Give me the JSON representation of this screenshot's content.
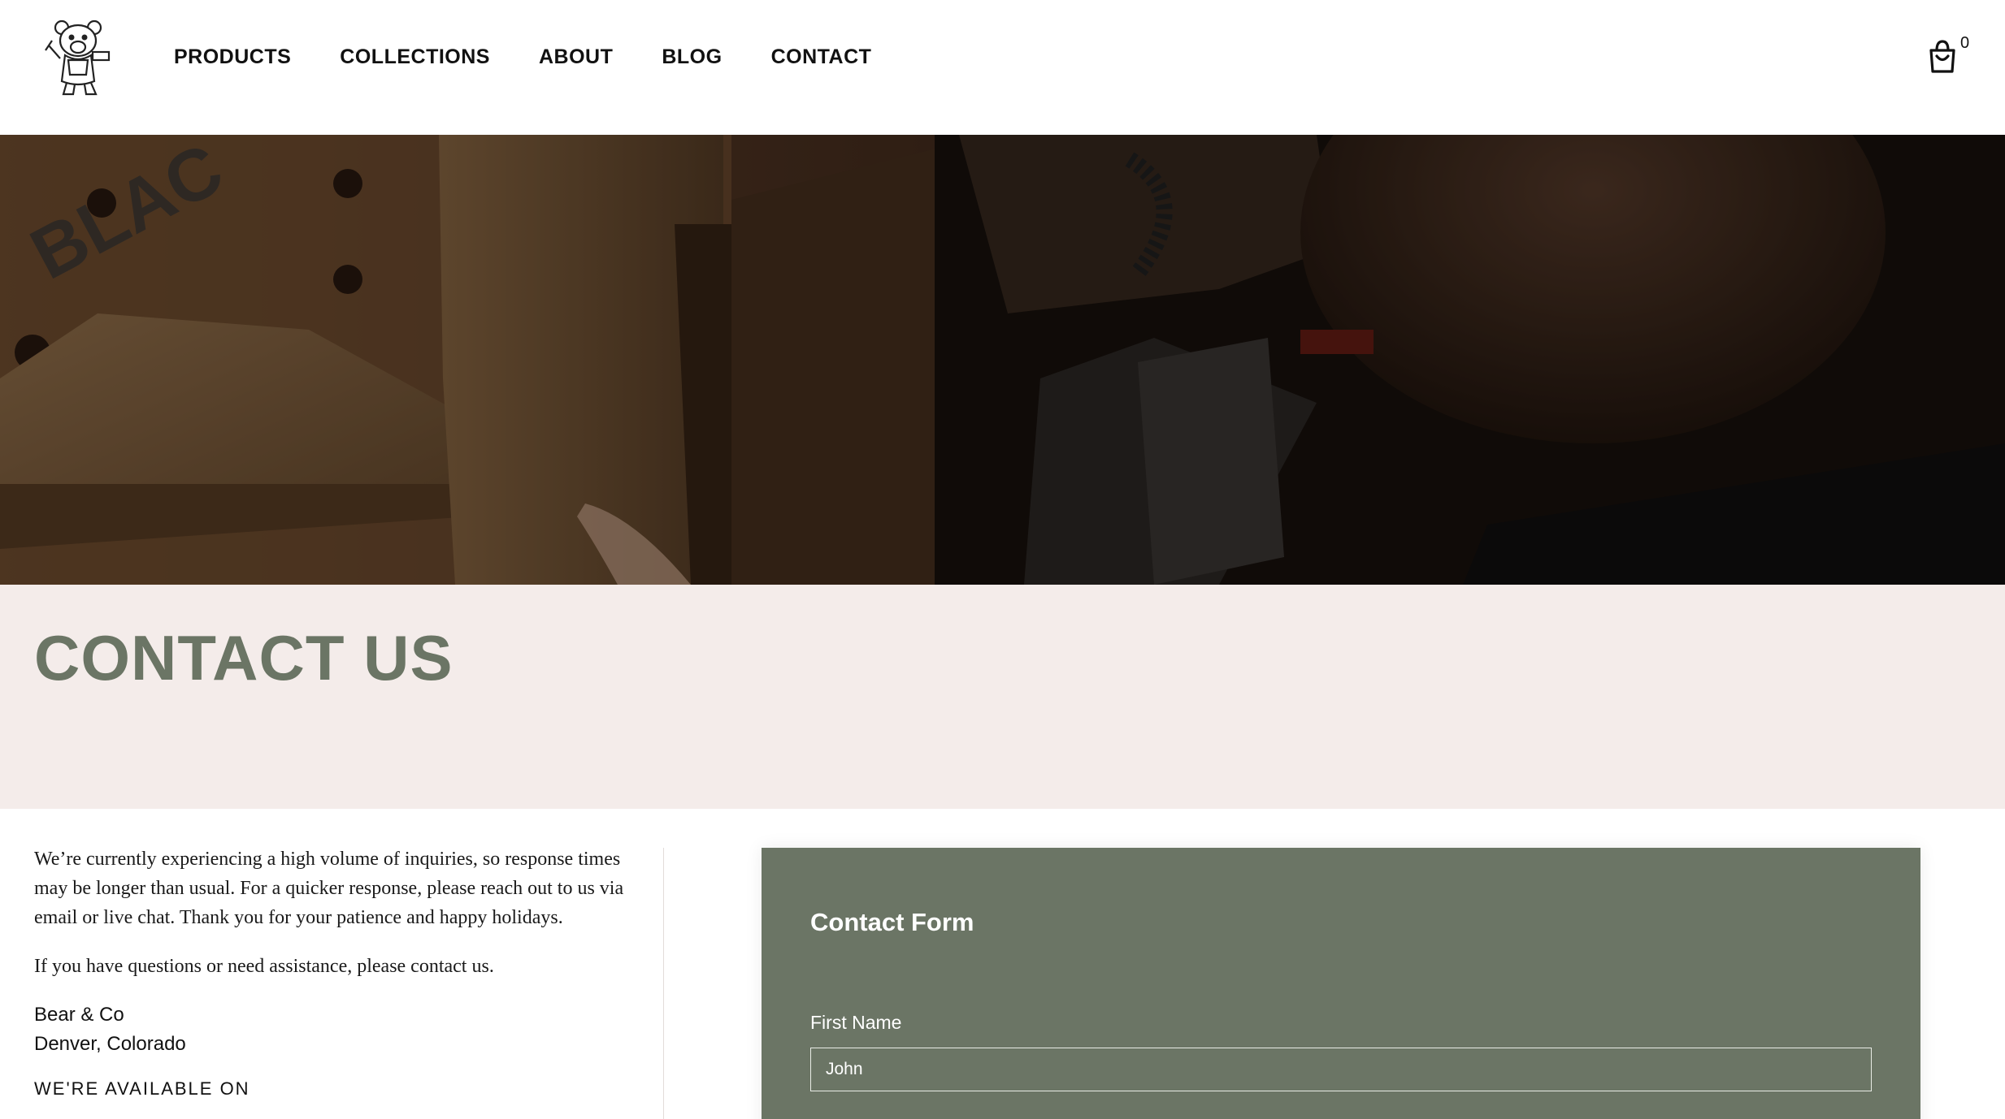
{
  "header": {
    "logo_name": "bear-mascot-logo",
    "nav": [
      "PRODUCTS",
      "COLLECTIONS",
      "ABOUT",
      "BLOG",
      "CONTACT"
    ],
    "cart_count": "0"
  },
  "page": {
    "title": "CONTACT US"
  },
  "info": {
    "paragraph1": "We’re currently experiencing a high volume of inquiries, so response times may be longer than usual. For a quicker response, please reach out to us via email or live chat. Thank you for your patience and happy holidays.",
    "paragraph2": "If you have questions or need assistance, please contact us.",
    "company": "Bear & Co",
    "location": "Denver, Colorado",
    "hours_heading": "WE'RE AVAILABLE ON"
  },
  "form": {
    "title": "Contact Form",
    "first_name_label": "First Name",
    "first_name_value": "John"
  },
  "colors": {
    "accent_green": "#6b7565",
    "title_band_bg": "#f4ecea"
  }
}
